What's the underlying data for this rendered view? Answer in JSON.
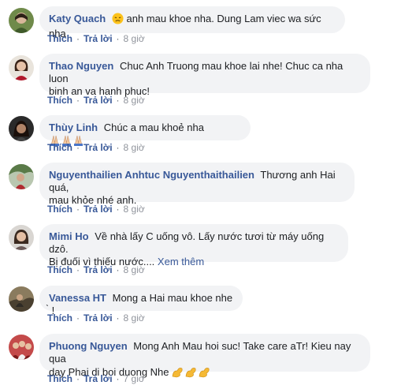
{
  "actions": {
    "like_label": "Thích",
    "reply_label": "Trả lời",
    "separator": "·"
  },
  "comments": [
    {
      "author": "Katy Quach",
      "text": "anh mau khoe nha. Dung Lam viec wa sức nha",
      "time": "8 giờ",
      "emoji": "disappointed-face"
    },
    {
      "author": "Thao Nguyen",
      "text_line1": "Chuc Anh Truong mau khoe lai nhe! Chuc ca nha luon",
      "text_line2": "binh an va hanh phuc!",
      "time": "8 giờ"
    },
    {
      "author": "Thùy Linh",
      "text": "Chúc a mau khoẻ nha",
      "time": "8 giờ",
      "emoji": "folded-hands x3"
    },
    {
      "author": "Nguyenthailien Anhtuc Nguyenthaithailien",
      "text_line1": "Thương anh Hai quá,",
      "text_line2": "mau khỏe nhé anh.",
      "time": "8 giờ"
    },
    {
      "author": "Mimi Ho",
      "text_line1": "Về nhà lấy C uống vô. Lấy nước tươi từ máy uống dzô.",
      "text_line2": "Bị đuối vì thiếu nước....",
      "see_more": "Xem thêm",
      "time": "8 giờ"
    },
    {
      "author": "Vanessa HT",
      "text": "Mong a Hai mau khoe nhe ̀ !",
      "time": "8 giờ"
    },
    {
      "author": "Phuong Nguyen",
      "text_line1": "Mong Anh Mau hoi suc! Take care aTr! Kieu nay qua",
      "text_line2": "day Phai di boi duong Nhe",
      "time": "7 giờ",
      "emoji": "flexed-biceps x3"
    }
  ]
}
